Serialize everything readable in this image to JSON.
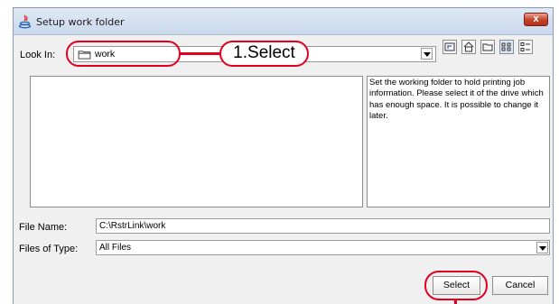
{
  "window": {
    "title": "Setup work folder",
    "close_label": "x"
  },
  "look_in": {
    "label": "Look In:",
    "value": "work"
  },
  "description": "Set the working folder to hold printing job information. Please select it of the drive which has enough space. It is possible to change it later.",
  "file_name": {
    "label": "File Name:",
    "value": "C:\\RstrLink\\work"
  },
  "files_of_type": {
    "label": "Files of Type:",
    "value": "All Files"
  },
  "buttons": {
    "select": "Select",
    "cancel": "Cancel"
  },
  "annotation": {
    "callout": "1.Select",
    "color": "#e3001f"
  },
  "icons": [
    "java-icon",
    "close-icon",
    "folder-icon",
    "up-folder-icon",
    "home-icon",
    "new-folder-icon",
    "list-view-icon",
    "details-view-icon",
    "dropdown-arrow-icon"
  ]
}
